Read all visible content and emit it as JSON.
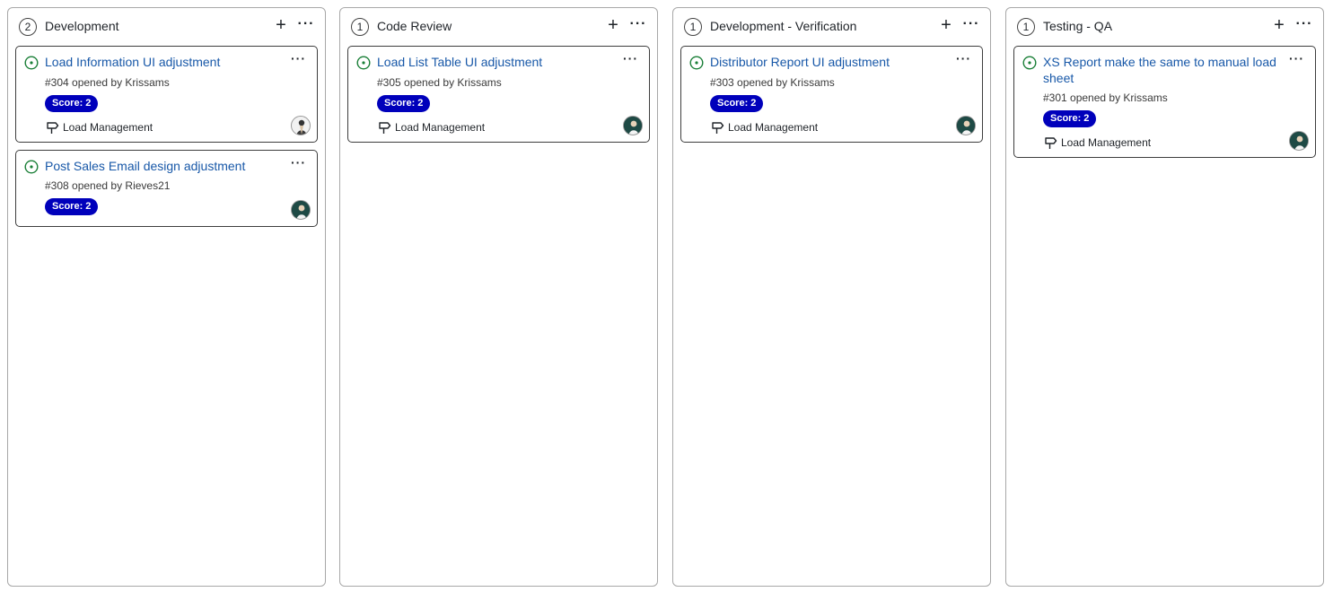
{
  "columns": [
    {
      "count": "2",
      "title": "Development",
      "cards": [
        {
          "title": "Load Information UI adjustment",
          "meta": "#304 opened by Krissams",
          "score": "Score: 2",
          "milestone": "Load Management"
        },
        {
          "title": "Post Sales Email design adjustment",
          "meta": "#308 opened by Rieves21",
          "score": "Score: 2"
        }
      ]
    },
    {
      "count": "1",
      "title": "Code Review",
      "cards": [
        {
          "title": "Load List Table UI adjustment",
          "meta": "#305 opened by Krissams",
          "score": "Score: 2",
          "milestone": "Load Management"
        }
      ]
    },
    {
      "count": "1",
      "title": "Development - Verification",
      "cards": [
        {
          "title": "Distributor Report UI adjustment",
          "meta": "#303 opened by Krissams",
          "score": "Score: 2",
          "milestone": "Load Management"
        }
      ]
    },
    {
      "count": "1",
      "title": "Testing - QA",
      "cards": [
        {
          "title": "XS Report make the same to manual load sheet",
          "meta": "#301 opened by Krissams",
          "score": "Score: 2",
          "milestone": "Load Management"
        }
      ]
    }
  ],
  "icons": {
    "add": "+",
    "more": "···",
    "status": "open-issue-icon",
    "milestone": "milestone-icon"
  },
  "colors": {
    "title_link": "#1858a8",
    "score_badge": "#0000bb",
    "open_status": "#1a7f37"
  }
}
